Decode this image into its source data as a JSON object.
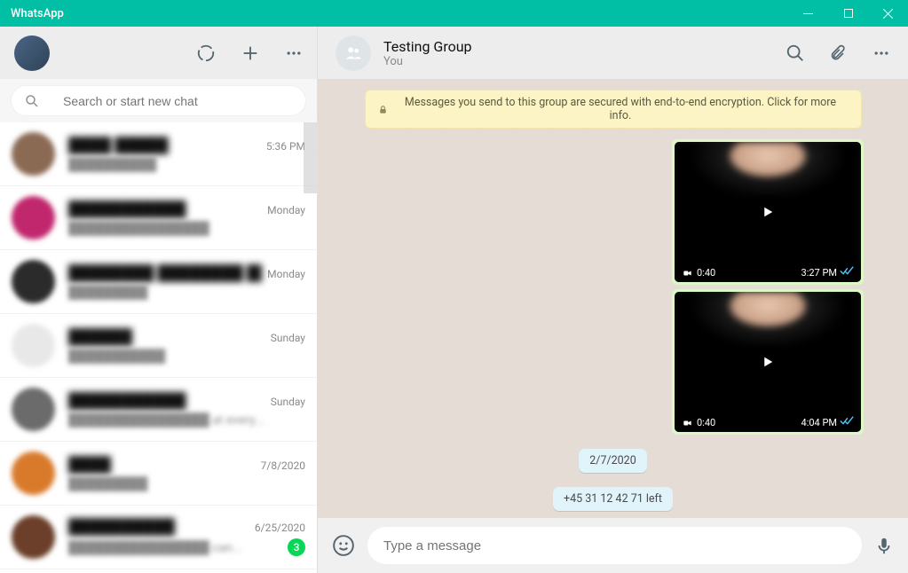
{
  "app": {
    "title": "WhatsApp"
  },
  "search": {
    "placeholder": "Search or start new chat"
  },
  "chats": [
    {
      "name": "████ █████",
      "preview": "██████████",
      "time": "5:36 PM",
      "avatar": "#8b6a54"
    },
    {
      "name": "███████████",
      "preview": "████████████████",
      "time": "Monday",
      "avatar": "#c1276d"
    },
    {
      "name": "████████ ████████ ████..",
      "preview": "█████████",
      "time": "Monday",
      "avatar": "#2b2b2b"
    },
    {
      "name": "██████",
      "preview": "███████████",
      "time": "Sunday",
      "avatar": "#e8e8e8"
    },
    {
      "name": "███████████",
      "preview": "████████████████ at every...",
      "time": "Sunday",
      "avatar": "#6b6b6b"
    },
    {
      "name": "████",
      "preview": "█████████",
      "time": "7/8/2020",
      "avatar": "#d97a2b"
    },
    {
      "name": "██████████",
      "preview": "████████████████ can...",
      "time": "6/25/2020",
      "avatar": "#6b3f2a",
      "badge": "3"
    }
  ],
  "convo_header": {
    "name": "Testing Group",
    "sub": "You"
  },
  "banner": "Messages you send to this group are secured with end-to-end encryption. Click for more info.",
  "videos": [
    {
      "duration": "0:40",
      "time": "3:27 PM"
    },
    {
      "duration": "0:40",
      "time": "4:04 PM"
    }
  ],
  "date_pill": "2/7/2020",
  "system_pill": "+45 31 12 42 71 left",
  "compose": {
    "placeholder": "Type a message"
  }
}
